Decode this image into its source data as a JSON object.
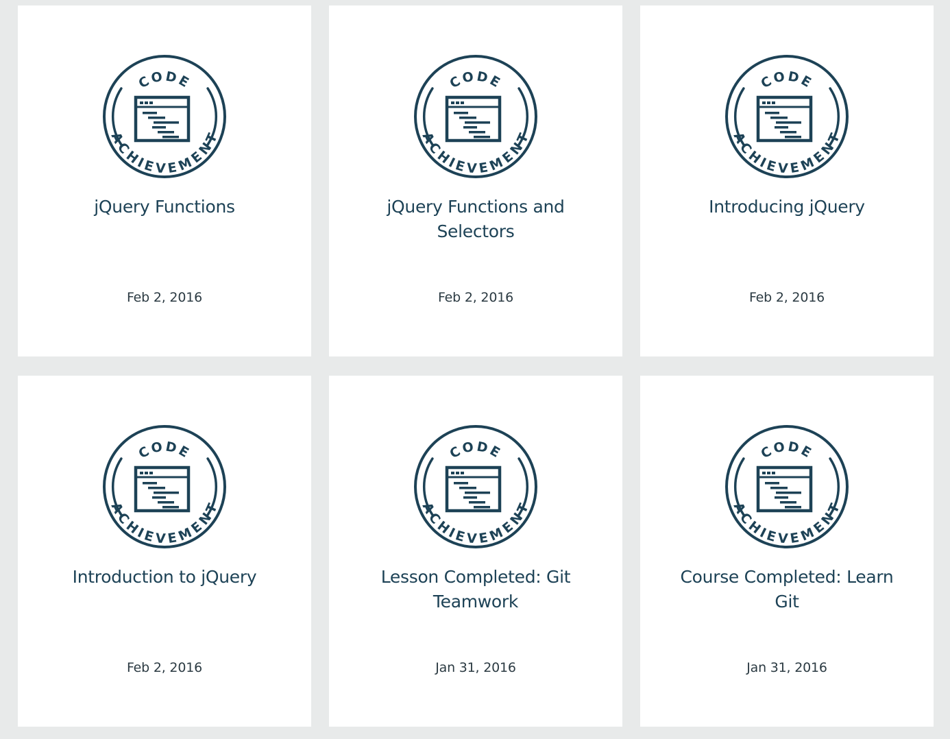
{
  "badge": {
    "top_text": "CODE",
    "bottom_text": "ACHIEVEMENT",
    "color": "#1d4256"
  },
  "achievements": [
    {
      "title": "jQuery Functions",
      "date": "Feb 2, 2016"
    },
    {
      "title": "jQuery Functions and Selectors",
      "date": "Feb 2, 2016"
    },
    {
      "title": "Introducing jQuery",
      "date": "Feb 2, 2016"
    },
    {
      "title": "Introduction to jQuery",
      "date": "Feb 2, 2016"
    },
    {
      "title": "Lesson Completed: Git Teamwork",
      "date": "Jan 31, 2016"
    },
    {
      "title": "Course Completed: Learn Git",
      "date": "Jan 31, 2016"
    }
  ]
}
